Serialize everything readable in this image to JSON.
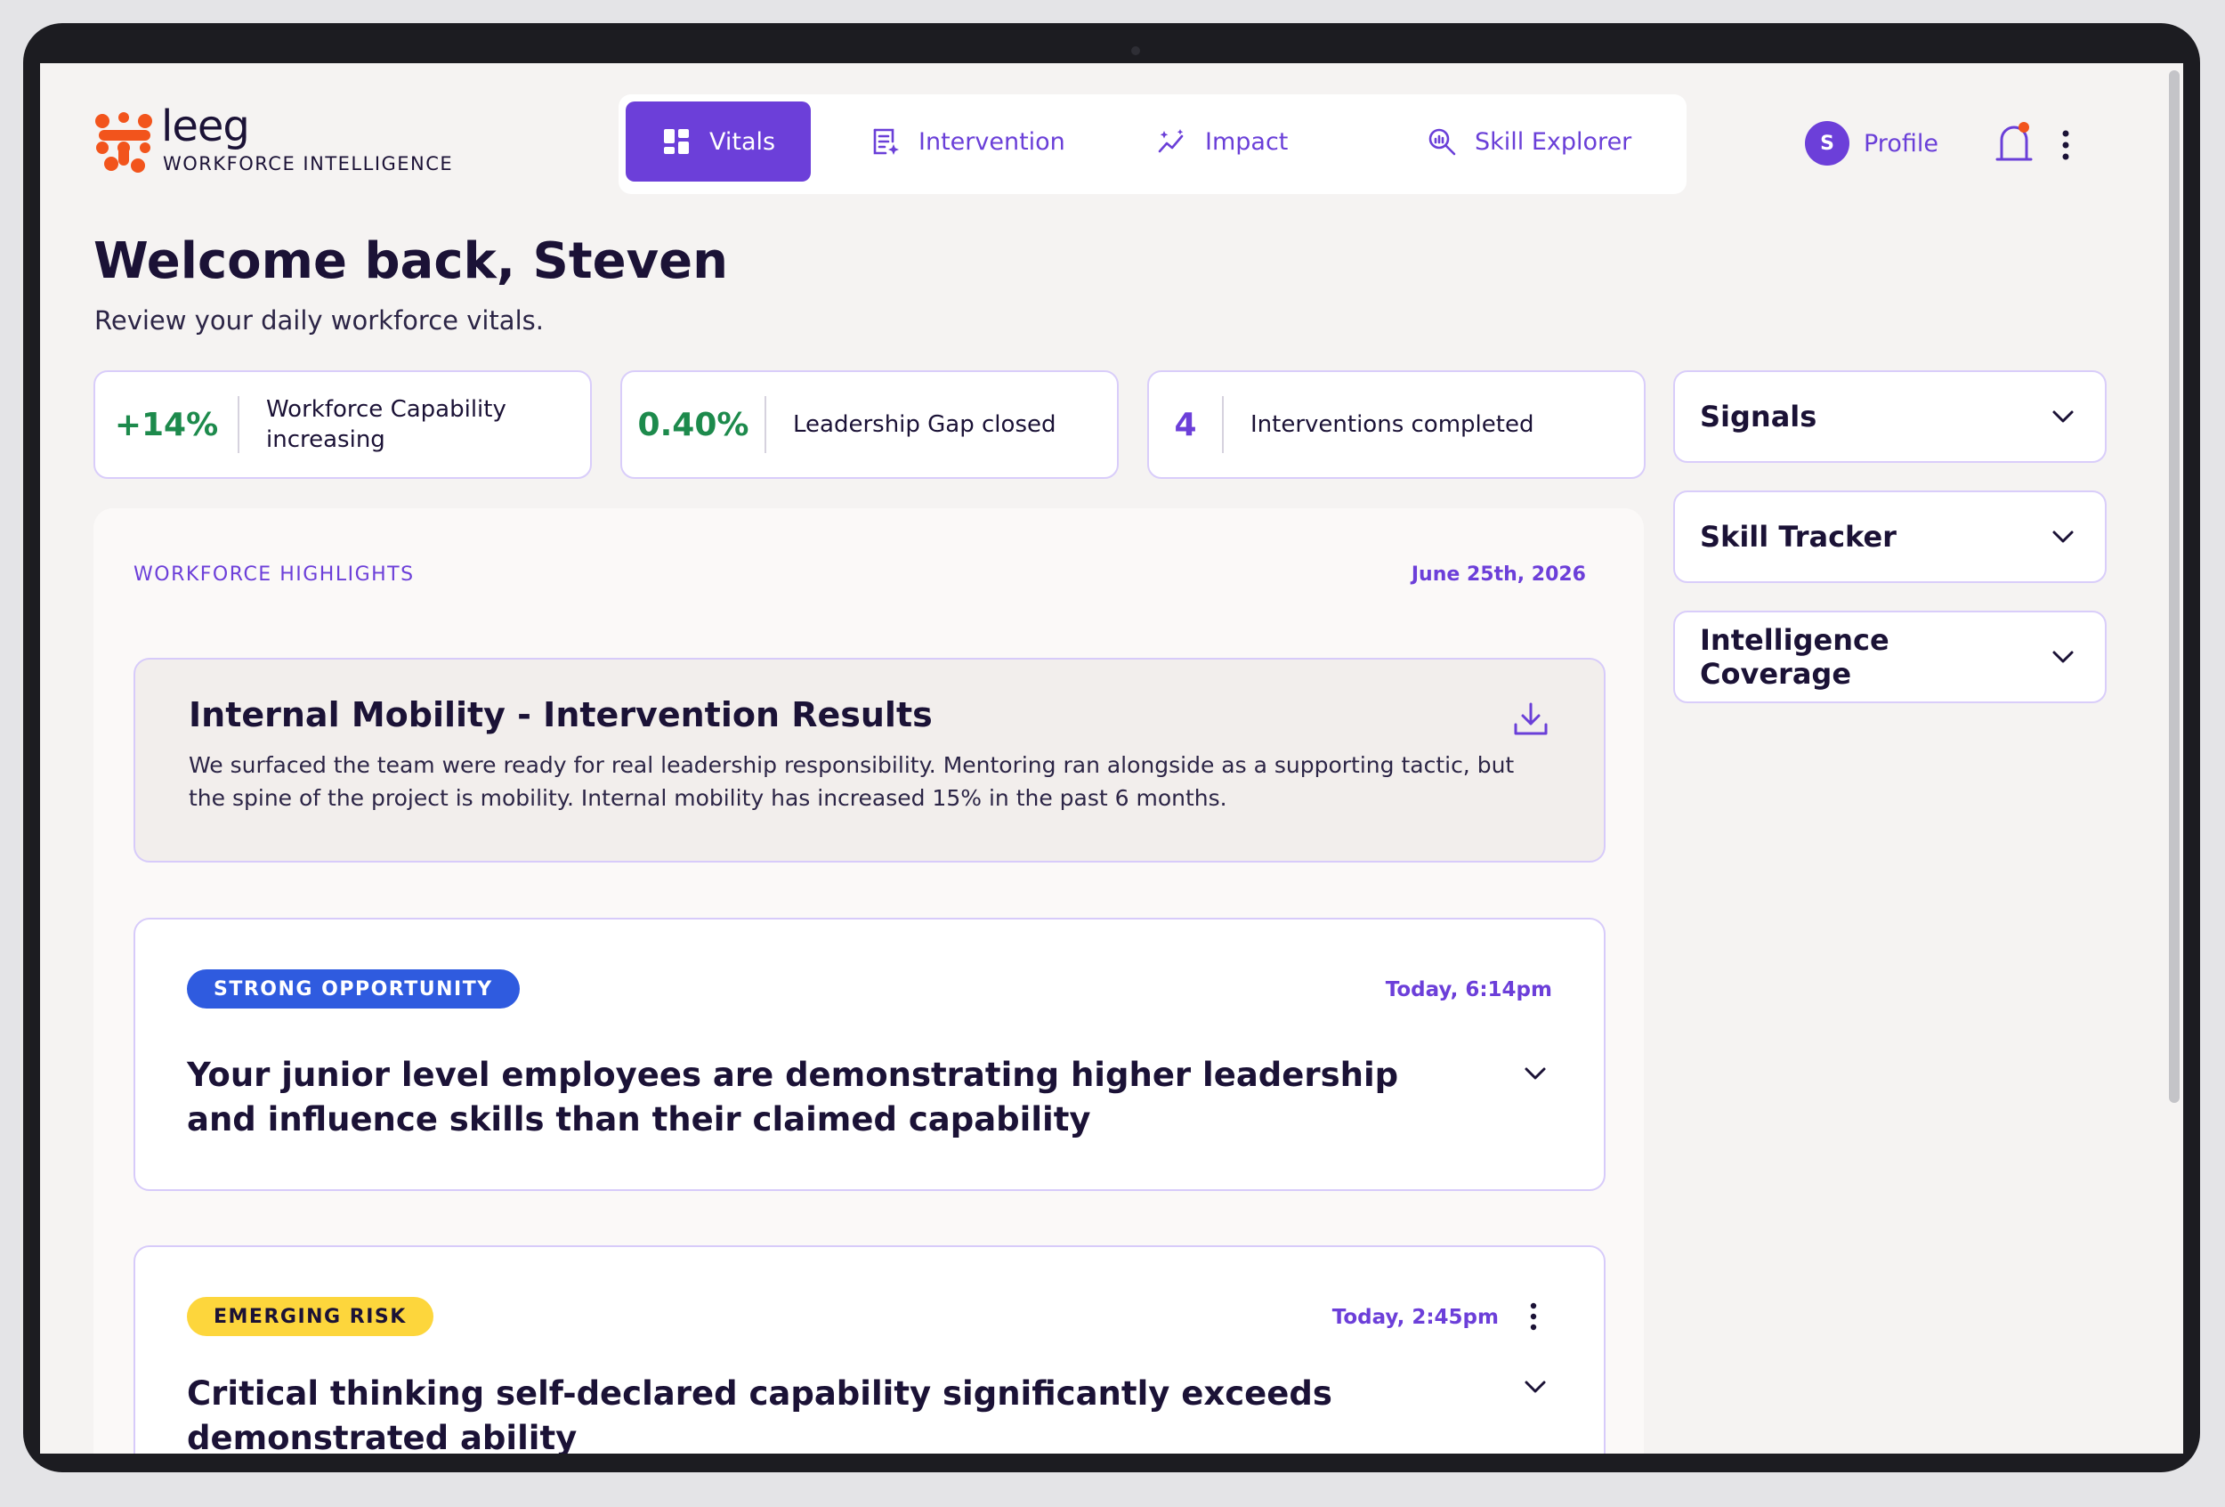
{
  "brand": {
    "name": "leeg",
    "tagline": "WORKFORCE INTELLIGENCE",
    "colors": {
      "primary": "#6c3fd9",
      "logo": "#f2541c",
      "text": "#1b1236"
    }
  },
  "nav": {
    "items": [
      {
        "label": "Vitals",
        "icon": "dashboard-grid-icon"
      },
      {
        "label": "Intervention",
        "icon": "document-sparkle-icon"
      },
      {
        "label": "Impact",
        "icon": "trend-sparkle-icon"
      },
      {
        "label": "Skill Explorer",
        "icon": "magnify-chart-icon"
      }
    ],
    "active": "Vitals"
  },
  "user": {
    "initial": "S",
    "profile_label": "Profile"
  },
  "welcome": {
    "title": "Welcome back, Steven",
    "subtitle": "Review your daily workforce vitals."
  },
  "stats": [
    {
      "value": "+14%",
      "label": "Workforce Capability increasing",
      "color": "#1d8a4c"
    },
    {
      "value": "0.40%",
      "label": "Leadership Gap closed",
      "color": "#1d8a4c"
    },
    {
      "value": "4",
      "label": "Interventions completed",
      "color": "#6c3fd9"
    }
  ],
  "side_panels": [
    {
      "label": "Signals"
    },
    {
      "label": "Skill Tracker"
    },
    {
      "label": "Intelligence Coverage"
    }
  ],
  "highlights": {
    "label": "WORKFORCE HIGHLIGHTS",
    "date": "June 25th, 2026",
    "result": {
      "title": "Internal Mobility - Intervention Results",
      "body": "We surfaced the team were ready for real leadership responsibility. Mentoring ran alongside as a supporting tactic, but the spine of the project is mobility. Internal mobility has increased 15% in the past 6 months."
    },
    "cards": [
      {
        "badge": "STRONG OPPORTUNITY",
        "badge_color": "#2f5bdf",
        "time": "Today, 6:14pm",
        "title": "Your junior level employees are demonstrating higher leadership and influence skills than their claimed capability"
      },
      {
        "badge": "EMERGING RISK",
        "badge_color": "#fdd63c",
        "time": "Today, 2:45pm",
        "title": "Critical thinking self-declared capability significantly exceeds demonstrated ability"
      }
    ]
  }
}
